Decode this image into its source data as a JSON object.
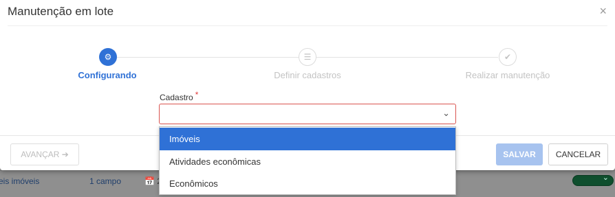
{
  "dialog": {
    "title": "Manutenção em lote",
    "close_icon": "×"
  },
  "stepper": {
    "steps": [
      {
        "label": "Configurando",
        "icon": "gears-icon",
        "glyph": "⚙",
        "state": "active"
      },
      {
        "label": "Definir cadastros",
        "icon": "list-icon",
        "glyph": "☰",
        "state": "idle"
      },
      {
        "label": "Realizar manutenção",
        "icon": "check-icon",
        "glyph": "✔",
        "state": "idle"
      }
    ]
  },
  "form": {
    "cadastro_label": "Cadastro",
    "required_mark": "*",
    "cadastro_value": "",
    "chevron": "⌄"
  },
  "dropdown": {
    "options": [
      "Imóveis",
      "Atividades econômicas",
      "Econômicos"
    ],
    "selected_index": 0
  },
  "footer": {
    "next_label": "AVANÇAR ➔",
    "save_label": "SALVAR",
    "cancel_label": "CANCELAR"
  },
  "background_row": {
    "col1": "eis imóveis",
    "col2": "1 campo",
    "col3": "📅 2"
  },
  "colors": {
    "accent": "#2f71d6",
    "error_border": "#d9534f",
    "save_disabled": "#a7c3ef"
  }
}
